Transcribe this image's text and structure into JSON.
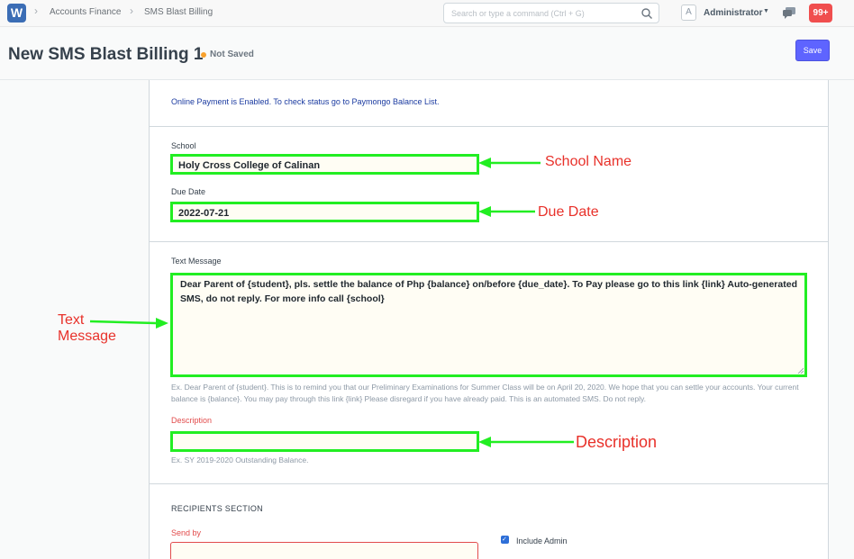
{
  "navbar": {
    "logo": "W",
    "breadcrumbs": [
      "Accounts Finance",
      "SMS Blast Billing"
    ],
    "search_placeholder": "Search or type a command (Ctrl + G)",
    "avatar_letter": "A",
    "user": "Administrator",
    "notification_count": "99+"
  },
  "header": {
    "title": "New SMS Blast Billing 1",
    "status": "Not Saved",
    "save_label": "Save"
  },
  "form": {
    "notice": "Online Payment is Enabled. To check status go to Paymongo Balance List.",
    "school_label": "School",
    "school_value": "Holy Cross College of Calinan",
    "due_date_label": "Due Date",
    "due_date_value": "2022-07-21",
    "text_message_label": "Text Message",
    "text_message_value": "Dear Parent of {student}, pls. settle the balance of Php {balance} on/before {due_date}. To Pay please go to this link {link} Auto-generated SMS, do not reply. For more info call {school}",
    "text_message_help": "Ex. Dear Parent of {student}. This is to remind you that our Preliminary Examinations for Summer Class will be on April 20, 2020. We hope that you can settle your accounts. Your current balance is {balance}. You may pay through this link {link} Please disregard if you have already paid. This is an automated SMS. Do not reply.",
    "description_label": "Description",
    "description_value": "",
    "description_help": "Ex. SY 2019-2020 Outstanding Balance.",
    "recipients_heading": "RECIPIENTS SECTION",
    "send_by_label": "Send by",
    "include_admin_label": "Include Admin",
    "include_admin_checked": true
  },
  "annotations": {
    "school": "School Name",
    "due_date": "Due Date",
    "text_message_line1": "Text",
    "text_message_line2": "Message",
    "description": "Description",
    "color": "#e8312a",
    "highlight_color": "#22ee22"
  },
  "colors": {
    "primary": "#5e64ff",
    "notification": "#f04e4e",
    "status_dot": "#f8a12d"
  }
}
